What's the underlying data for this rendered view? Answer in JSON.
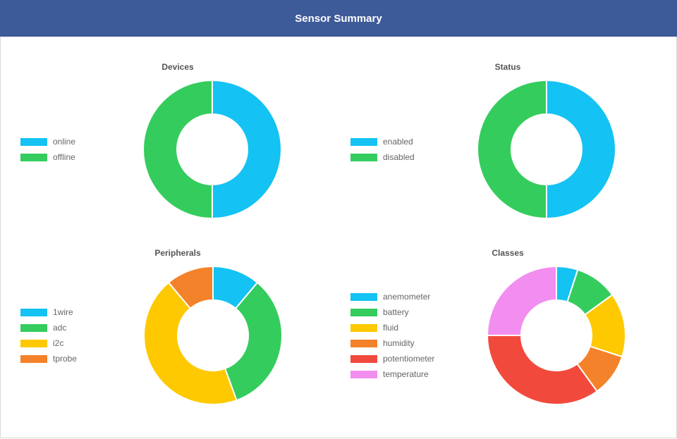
{
  "header": {
    "title": "Sensor Summary"
  },
  "chart_data": [
    {
      "type": "pie",
      "subtype": "doughnut",
      "title": "Devices",
      "categories": [
        "online",
        "offline"
      ],
      "values": [
        1,
        1
      ],
      "colors": [
        "#14c2f3",
        "#35cc5e"
      ],
      "legend": "left"
    },
    {
      "type": "pie",
      "subtype": "doughnut",
      "title": "Status",
      "categories": [
        "enabled",
        "disabled"
      ],
      "values": [
        1,
        1
      ],
      "colors": [
        "#14c2f3",
        "#35cc5e"
      ],
      "legend": "left"
    },
    {
      "type": "pie",
      "subtype": "doughnut",
      "title": "Peripherals",
      "categories": [
        "1wire",
        "adc",
        "i2c",
        "tprobe"
      ],
      "values": [
        1,
        3,
        4,
        1
      ],
      "colors": [
        "#14c2f3",
        "#35cc5e",
        "#fec901",
        "#f4822a"
      ],
      "legend": "left"
    },
    {
      "type": "pie",
      "subtype": "doughnut",
      "title": "Classes",
      "categories": [
        "anemometer",
        "battery",
        "fluid",
        "humidity",
        "potentiometer",
        "temperature"
      ],
      "values": [
        1,
        2,
        3,
        2,
        7,
        5
      ],
      "colors": [
        "#14c2f3",
        "#35cc5e",
        "#fec901",
        "#f4822a",
        "#f14a3d",
        "#f28ef0"
      ],
      "legend": "left"
    }
  ]
}
